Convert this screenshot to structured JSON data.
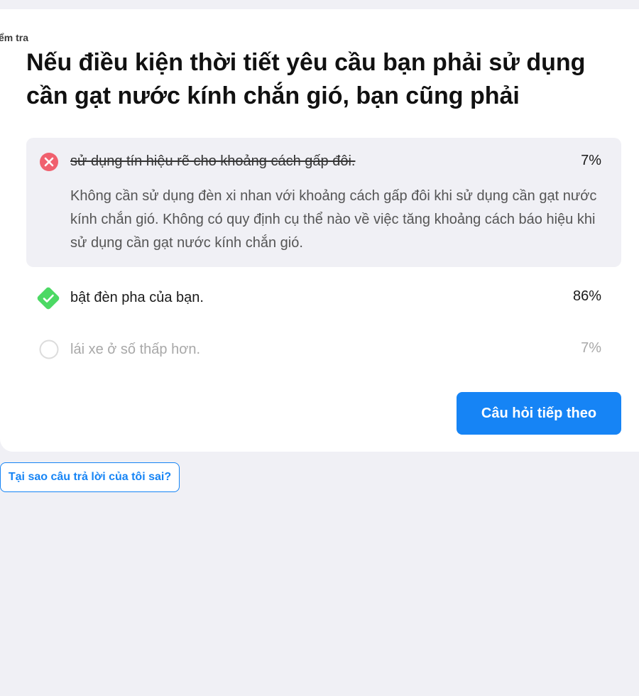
{
  "breadcrumb": "Kiểm tra",
  "question": "Nếu điều kiện thời tiết yêu cầu bạn phải sử dụng cần gạt nước kính chắn gió, bạn cũng phải",
  "answers": [
    {
      "text": "sử dụng tín hiệu rẽ cho khoảng cách gấp đôi.",
      "percent": "7%",
      "status": "wrong",
      "explanation": "Không cần sử dụng đèn xi nhan với khoảng cách gấp đôi khi sử dụng cần gạt nước kính chắn gió. Không có quy định cụ thể nào về việc tăng khoảng cách báo hiệu khi sử dụng cần gạt nước kính chắn gió."
    },
    {
      "text": "bật đèn pha của bạn.",
      "percent": "86%",
      "status": "correct"
    },
    {
      "text": "lái xe ở số thấp hơn.",
      "percent": "7%",
      "status": "neutral"
    }
  ],
  "next_button": "Câu hỏi tiếp theo",
  "why_button": "Tại sao câu trả lời của tôi sai?",
  "colors": {
    "accent": "#1684f5",
    "wrong": "#f0606e",
    "correct": "#4cd964",
    "background": "#f0f0f5"
  },
  "icons": {
    "wrong": "x-circle-icon",
    "correct": "check-diamond-icon",
    "neutral": "empty-circle-icon"
  }
}
